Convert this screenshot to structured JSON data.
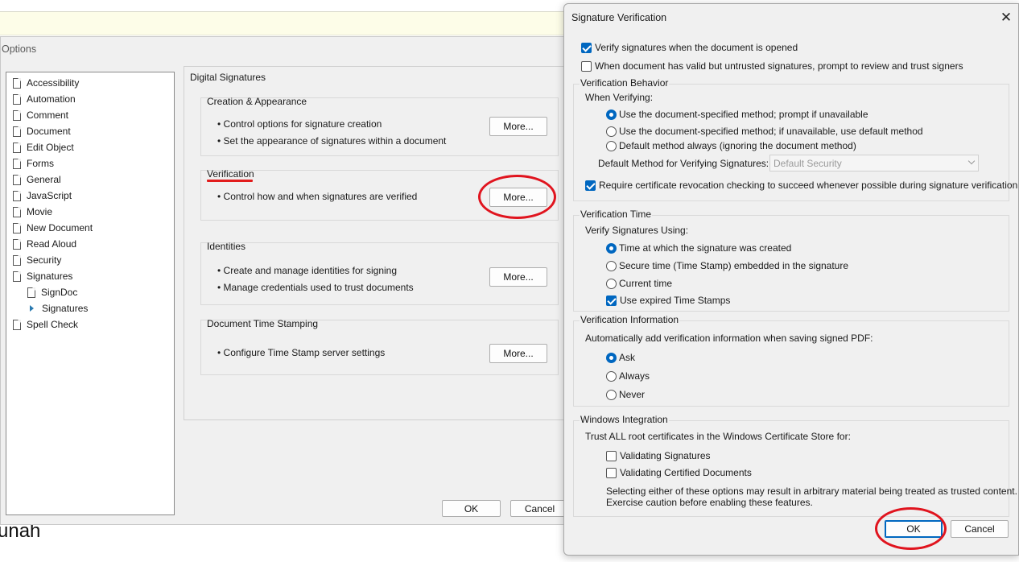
{
  "background": {
    "partial_text": "unah"
  },
  "preferences": {
    "title": "Options",
    "categories": [
      {
        "label": "Accessibility",
        "level": 0
      },
      {
        "label": "Automation",
        "level": 0
      },
      {
        "label": "Comment",
        "level": 0
      },
      {
        "label": "Document",
        "level": 0
      },
      {
        "label": "Edit Object",
        "level": 0
      },
      {
        "label": "Forms",
        "level": 0
      },
      {
        "label": "General",
        "level": 0
      },
      {
        "label": "JavaScript",
        "level": 0
      },
      {
        "label": "Movie",
        "level": 0
      },
      {
        "label": "New Document",
        "level": 0
      },
      {
        "label": "Read Aloud",
        "level": 0
      },
      {
        "label": "Security",
        "level": 0
      },
      {
        "label": "Signatures",
        "level": 0
      },
      {
        "label": "SignDoc",
        "level": 1
      },
      {
        "label": "Signatures",
        "level": 1,
        "selected": true
      },
      {
        "label": "Spell Check",
        "level": 0
      }
    ],
    "panel_title": "Digital Signatures",
    "groups": {
      "creation": {
        "title": "Creation & Appearance",
        "bullets": [
          "• Control options for signature creation",
          "• Set the appearance of signatures within a document"
        ],
        "button": "More..."
      },
      "verification": {
        "title": "Verification",
        "bullets": [
          "• Control how and when signatures are verified"
        ],
        "button": "More..."
      },
      "identities": {
        "title": "Identities",
        "bullets": [
          "• Create and manage identities for signing",
          "• Manage credentials used to trust documents"
        ],
        "button": "More..."
      },
      "timestamping": {
        "title": "Document Time Stamping",
        "bullets": [
          "• Configure Time Stamp server settings"
        ],
        "button": "More..."
      }
    },
    "ok_label": "OK",
    "cancel_label": "Cancel"
  },
  "dialog": {
    "title": "Signature Verification",
    "close_glyph": "✕",
    "top_options": {
      "verify_on_open": {
        "label": "Verify signatures when the document is opened",
        "checked": true
      },
      "prompt_untrusted": {
        "label": "When document has valid but untrusted signatures, prompt to review and trust signers",
        "checked": false
      }
    },
    "behavior": {
      "title": "Verification Behavior",
      "subtitle": "When Verifying:",
      "options": [
        {
          "label": "Use the document-specified method; prompt if unavailable",
          "selected": true
        },
        {
          "label": "Use the document-specified method; if unavailable, use default method",
          "selected": false
        },
        {
          "label": "Default method always (ignoring the document method)",
          "selected": false
        }
      ],
      "default_method_label": "Default Method for Verifying Signatures:",
      "default_method_value": "Default Security",
      "revocation": {
        "label": "Require certificate revocation checking to succeed whenever possible during signature verification",
        "checked": true
      }
    },
    "time": {
      "title": "Verification Time",
      "subtitle": "Verify Signatures Using:",
      "options": [
        {
          "label": "Time at which the signature was created",
          "selected": true
        },
        {
          "label": "Secure time (Time Stamp) embedded in the signature",
          "selected": false
        },
        {
          "label": "Current time",
          "selected": false
        }
      ],
      "expired": {
        "label": "Use expired Time Stamps",
        "checked": true
      }
    },
    "info": {
      "title": "Verification Information",
      "subtitle": "Automatically add verification information when saving signed PDF:",
      "options": [
        {
          "label": "Ask",
          "selected": true
        },
        {
          "label": "Always",
          "selected": false
        },
        {
          "label": "Never",
          "selected": false
        }
      ]
    },
    "windows": {
      "title": "Windows Integration",
      "subtitle": "Trust ALL root certificates in the Windows Certificate Store for:",
      "options": [
        {
          "label": "Validating Signatures",
          "checked": false
        },
        {
          "label": "Validating Certified Documents",
          "checked": false
        }
      ],
      "note_line1": "Selecting either of these options may result in arbitrary material being treated as trusted content.",
      "note_line2": "Exercise caution before enabling these features."
    },
    "ok_label": "OK",
    "cancel_label": "Cancel"
  }
}
